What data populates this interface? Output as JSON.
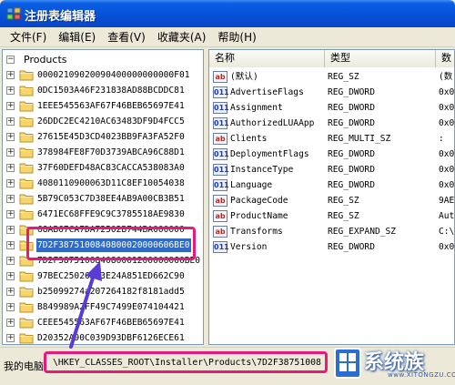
{
  "window": {
    "title": "注册表编辑器"
  },
  "menu": [
    "文件(F)",
    "编辑(E)",
    "查看(V)",
    "收藏夹(A)",
    "帮助(H)"
  ],
  "tree": {
    "root": "Products",
    "items": [
      "00002109020090400000000000F01",
      "0DC1503A46F231838AD88BCDDC81",
      "1EEE545563AF67F46BEB65697E41",
      "26DDC2EC4210AC63483DF9D4FCC5",
      "27615E45D3CD4023BB9FA3FA52F0",
      "378984FE8F70D3739ABCA96C88D1",
      "37F60DEFD48AC83CACCA538083A0",
      "4080110900063D11C8EF10054038",
      "5B79C053C7D38EE4AB9A00CB3B51",
      "6471EC68FFE9C9C3785518AE9830",
      "68AB67CA7DA72502B744BA000000",
      "7D2F3875100840800020000606BE0",
      "7D2F387510084080001200006060BE0",
      "97BEC25026D93E24A851ED662C90",
      "b25099274a207264182f8181add5",
      "B849989A2FF49C7499E074104421",
      "CEEE545563AF67F46BEB65697E41",
      "D20352A90C039D93DBF6126ECE61"
    ],
    "selected_index": 11
  },
  "list": {
    "columns": [
      "名称",
      "类型",
      "数"
    ],
    "rows": [
      {
        "name": "(默认)",
        "type": "REG_SZ",
        "data": "(数",
        "kind": "sz"
      },
      {
        "name": "AdvertiseFlags",
        "type": "REG_DWORD",
        "data": "0x0",
        "kind": "dword"
      },
      {
        "name": "Assignment",
        "type": "REG_DWORD",
        "data": "0x0",
        "kind": "dword"
      },
      {
        "name": "AuthorizedLUAApp",
        "type": "REG_DWORD",
        "data": "0x0",
        "kind": "dword"
      },
      {
        "name": "Clients",
        "type": "REG_MULTI_SZ",
        "data": ":",
        "kind": "sz"
      },
      {
        "name": "DeploymentFlags",
        "type": "REG_DWORD",
        "data": "0x0",
        "kind": "dword"
      },
      {
        "name": "InstanceType",
        "type": "REG_DWORD",
        "data": "0x0",
        "kind": "dword"
      },
      {
        "name": "Language",
        "type": "REG_DWORD",
        "data": "0x0",
        "kind": "dword"
      },
      {
        "name": "PackageCode",
        "type": "REG_SZ",
        "data": "9AE",
        "kind": "sz"
      },
      {
        "name": "ProductName",
        "type": "REG_SZ",
        "data": "Aut",
        "kind": "sz"
      },
      {
        "name": "Transforms",
        "type": "REG_EXPAND_SZ",
        "data": "C:\\",
        "kind": "sz"
      },
      {
        "name": "Version",
        "type": "REG_DWORD",
        "data": "0x0",
        "kind": "dword"
      }
    ]
  },
  "status": {
    "prefix": "我的电脑",
    "path": "\\HKEY_CLASSES_ROOT\\Installer\\Products\\7D2F38751008"
  },
  "logo": {
    "text": "系统族",
    "subtext": "www.XITONGZU.COM"
  },
  "colors": {
    "title_bar": "#0551d8",
    "selection": "#316ac5",
    "annotation": "#e8197a"
  }
}
